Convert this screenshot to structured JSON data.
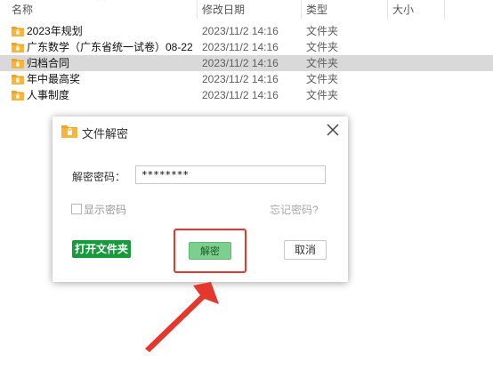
{
  "explorer": {
    "columns": {
      "name": "名称",
      "date": "修改日期",
      "type": "类型",
      "size": "大小"
    },
    "rows": [
      {
        "name": "2023年规划",
        "date": "2023/11/2 14:16",
        "type": "文件夹",
        "selected": false
      },
      {
        "name": "广东数学（广东省统一试卷）08-22",
        "date": "2023/11/2 14:16",
        "type": "文件夹",
        "selected": false
      },
      {
        "name": "归档合同",
        "date": "2023/11/2 14:16",
        "type": "文件夹",
        "selected": true
      },
      {
        "name": "年中最高奖",
        "date": "2023/11/2 14:16",
        "type": "文件夹",
        "selected": false
      },
      {
        "name": "人事制度",
        "date": "2023/11/2 14:16",
        "type": "文件夹",
        "selected": false
      }
    ]
  },
  "dialog": {
    "title": "文件解密",
    "password_label": "解密密码：",
    "password_value": "********",
    "show_password_label": "显示密码",
    "show_password_checked": false,
    "forgot_password": "忘记密码?",
    "open_folder_button": "打开文件夹",
    "decrypt_button": "解密",
    "cancel_button": "取消"
  },
  "colors": {
    "accent_green": "#159b3c",
    "decrypt_green": "#7ccf8f",
    "highlight_red": "#e5372c",
    "folder_orange": "#f5a21b",
    "selected_row": "#d9d9d9"
  }
}
